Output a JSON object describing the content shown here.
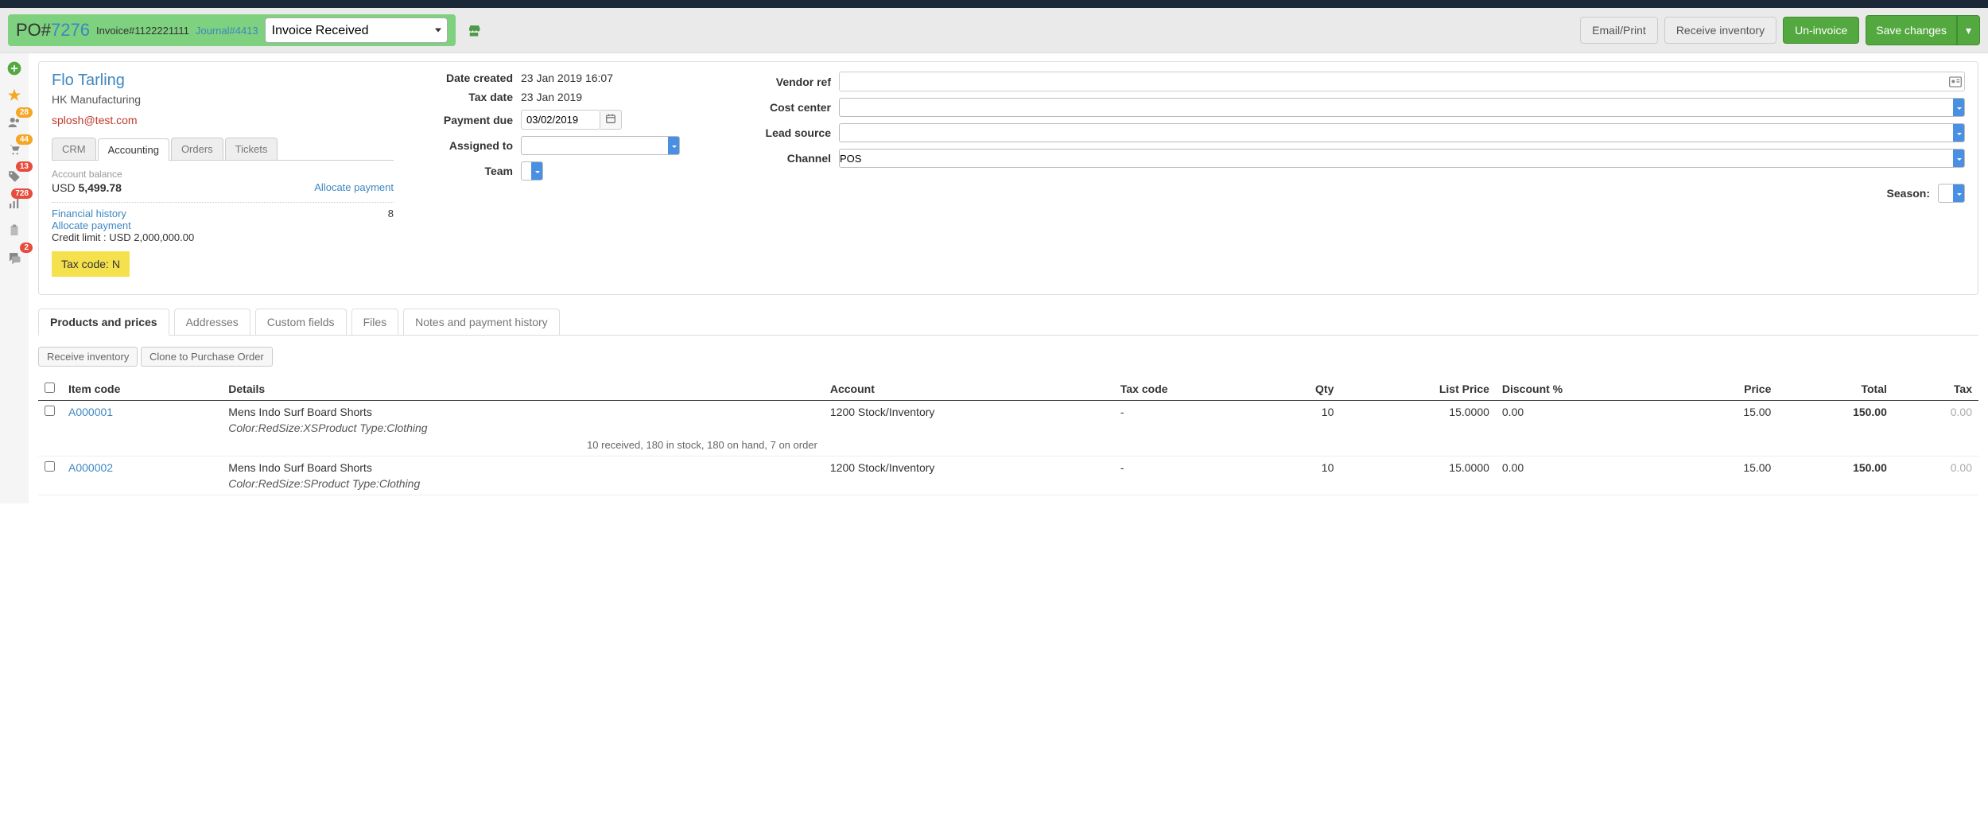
{
  "header": {
    "po_prefix": "PO#",
    "po_number": "7276",
    "invoice_label": "Invoice#1122221111",
    "journal_label": "Journal#4413",
    "status": "Invoice Received",
    "buttons": {
      "email_print": "Email/Print",
      "receive_inventory": "Receive inventory",
      "un_invoice": "Un-invoice",
      "save": "Save changes"
    }
  },
  "sidebar_badges": {
    "users": "28",
    "cart": "44",
    "tag": "13",
    "chart": "728",
    "chat": "2"
  },
  "vendor": {
    "name": "Flo Tarling",
    "company": "HK Manufacturing",
    "email": "splosh@test.com",
    "tabs": {
      "crm": "CRM",
      "accounting": "Accounting",
      "orders": "Orders",
      "tickets": "Tickets"
    },
    "account_balance_label": "Account balance",
    "currency": "USD",
    "balance": "5,499.78",
    "allocate_payment": "Allocate payment",
    "financial_history": "Financial history",
    "fin_count": "8",
    "credit_limit": "Credit limit : USD 2,000,000.00",
    "tax_code": "Tax code: N"
  },
  "meta": {
    "date_created_label": "Date created",
    "date_created": "23 Jan 2019 16:07",
    "tax_date_label": "Tax date",
    "tax_date": "23 Jan 2019",
    "payment_due_label": "Payment due",
    "payment_due": "03/02/2019",
    "assigned_to_label": "Assigned to",
    "team_label": "Team",
    "vendor_ref_label": "Vendor ref",
    "cost_center_label": "Cost center",
    "lead_source_label": "Lead source",
    "channel_label": "Channel",
    "channel_value": "POS",
    "season_label": "Season:"
  },
  "lower_tabs": {
    "products": "Products and prices",
    "addresses": "Addresses",
    "custom": "Custom fields",
    "files": "Files",
    "notes": "Notes and payment history"
  },
  "actions": {
    "receive_inventory": "Receive inventory",
    "clone": "Clone to Purchase Order"
  },
  "table": {
    "headers": {
      "item_code": "Item code",
      "details": "Details",
      "account": "Account",
      "tax_code": "Tax code",
      "qty": "Qty",
      "list_price": "List Price",
      "discount": "Discount %",
      "price": "Price",
      "total": "Total",
      "tax": "Tax"
    },
    "rows": [
      {
        "code": "A000001",
        "name": "Mens Indo Surf Board Shorts",
        "meta": "Color:RedSize:XSProduct Type:Clothing",
        "stock": "10 received, 180 in stock, 180 on hand, 7 on order",
        "account": "1200 Stock/Inventory",
        "tax_code": "-",
        "qty": "10",
        "list_price": "15.0000",
        "discount": "0.00",
        "price": "15.00",
        "total": "150.00",
        "tax": "0.00"
      },
      {
        "code": "A000002",
        "name": "Mens Indo Surf Board Shorts",
        "meta": "Color:RedSize:SProduct Type:Clothing",
        "stock": "",
        "account": "1200 Stock/Inventory",
        "tax_code": "-",
        "qty": "10",
        "list_price": "15.0000",
        "discount": "0.00",
        "price": "15.00",
        "total": "150.00",
        "tax": "0.00"
      }
    ]
  }
}
